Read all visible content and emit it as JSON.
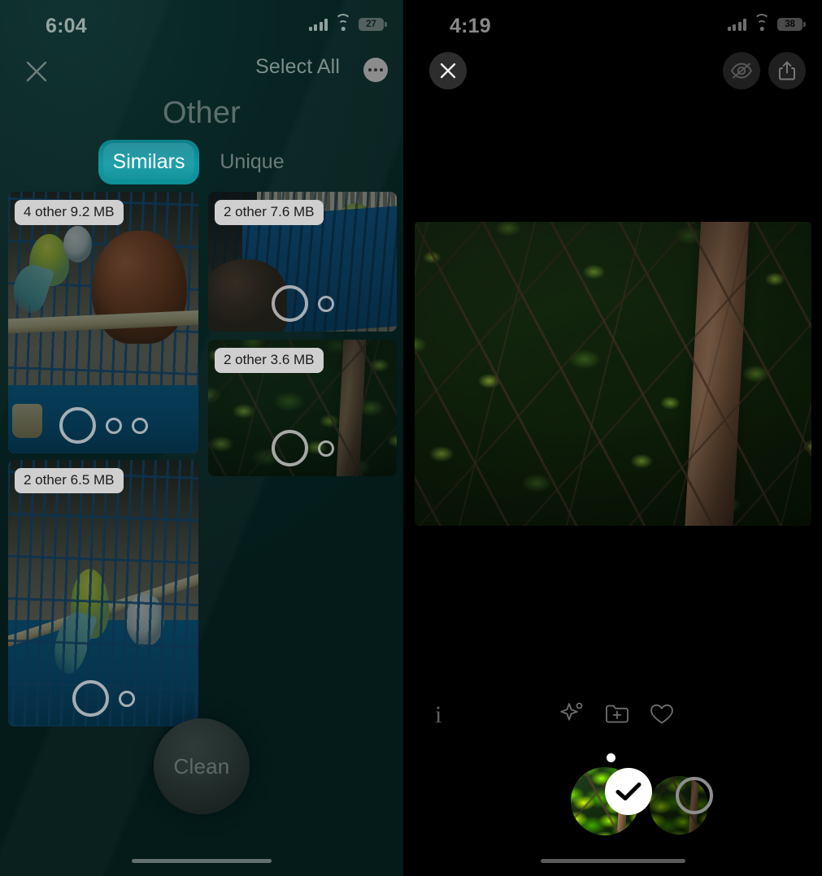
{
  "left": {
    "status": {
      "time": "6:04",
      "battery": "27",
      "signal_icon": "cellular-bars-icon",
      "wifi_icon": "wifi-icon",
      "battery_icon": "battery-icon"
    },
    "nav": {
      "close_icon": "close-icon",
      "select_all_label": "Select All",
      "more_icon": "more-options-icon"
    },
    "title": "Other",
    "tabs": [
      {
        "label": "Similars",
        "active": true
      },
      {
        "label": "Unique",
        "active": false
      }
    ],
    "grid": [
      {
        "badge": "4 other 9.2 MB",
        "dots": 3,
        "art": "birdcage-parakeets"
      },
      {
        "badge": "2 other 7.6 MB",
        "dots": 2,
        "art": "blue-cage-closeup"
      },
      {
        "badge": "2 other 3.6 MB",
        "dots": 2,
        "art": "foliage-branches"
      },
      {
        "badge": "2 other 6.5 MB",
        "dots": 2,
        "art": "birdcage-two-birds"
      }
    ],
    "clean_button": "Clean",
    "home_indicator": "home-indicator"
  },
  "right": {
    "status": {
      "time": "4:19",
      "battery": "38",
      "signal_icon": "cellular-bars-icon",
      "wifi_icon": "wifi-icon",
      "battery_icon": "battery-icon"
    },
    "nav": {
      "close_icon": "close-icon",
      "hide_icon": "eye-slash-icon",
      "share_icon": "share-icon"
    },
    "photo": "foliage-branches-large",
    "toolbar": [
      {
        "icon": "info-icon",
        "glyph": "i"
      },
      {
        "icon": "magic-wand-sparkle-icon"
      },
      {
        "icon": "folder-plus-icon"
      },
      {
        "icon": "heart-icon"
      }
    ],
    "filmstrip": {
      "page_dot": "page-indicator-dot",
      "thumbnails": [
        {
          "selected": true,
          "mark": "check-icon"
        },
        {
          "selected": false,
          "mark": "unselected-ring"
        }
      ]
    },
    "home_indicator": "home-indicator"
  },
  "colors": {
    "left_bg": "#072422",
    "tab_active": "#119aa4",
    "badge_bg": "#cfcfcf",
    "right_bg": "#000000",
    "accent_white": "#ffffff"
  }
}
